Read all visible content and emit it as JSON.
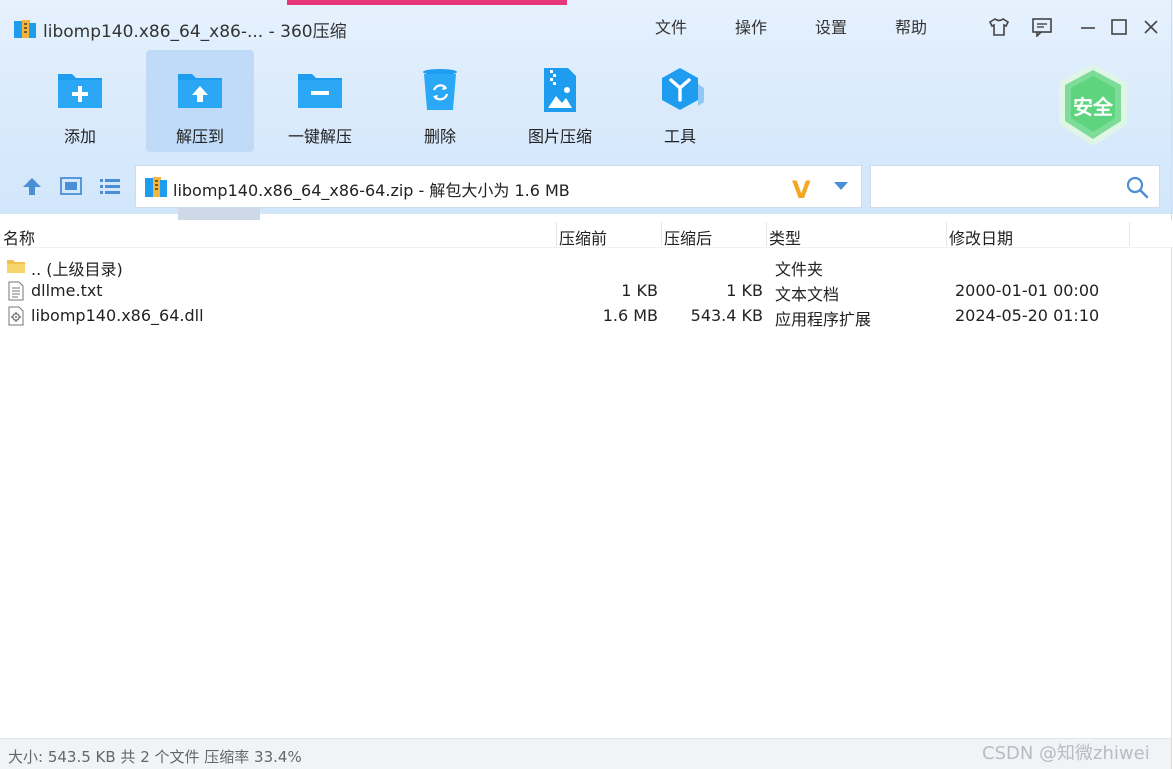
{
  "window": {
    "title": "libomp140.x86_64_x86-... - 360压缩",
    "menus": [
      "文件",
      "操作",
      "设置",
      "帮助"
    ]
  },
  "toolbar": {
    "add": "添加",
    "extract_to": "解压到",
    "one_click_extract": "一键解压",
    "delete": "删除",
    "image_compress": "图片压缩",
    "tools": "工具"
  },
  "shield": {
    "label": "安全"
  },
  "address": {
    "path": "libomp140.x86_64_x86-64.zip - 解包大小为 1.6 MB",
    "logo": "V"
  },
  "search": {
    "placeholder": ""
  },
  "columns": {
    "name": "名称",
    "compressed_before": "压缩前",
    "compressed_after": "压缩后",
    "type": "类型",
    "modified": "修改日期"
  },
  "files": [
    {
      "name": ".. (上级目录)",
      "before": "",
      "after": "",
      "type": "文件夹",
      "modified": "",
      "icon": "folder-icon"
    },
    {
      "name": "dllme.txt",
      "before": "1 KB",
      "after": "1 KB",
      "type": "文本文档",
      "modified": "2000-01-01 00:00",
      "icon": "text-file-icon"
    },
    {
      "name": "libomp140.x86_64.dll",
      "before": "1.6 MB",
      "after": "543.4 KB",
      "type": "应用程序扩展",
      "modified": "2024-05-20 01:10",
      "icon": "dll-file-icon"
    }
  ],
  "status": {
    "text": "大小: 543.5 KB 共 2 个文件 压缩率 33.4%"
  },
  "watermark": "CSDN @知微zhiwei",
  "colors": {
    "accent": "#1e9cf0",
    "toolbar_bg": "#d9eafc",
    "active_tool": "#bfdbf8",
    "shield": "#5fd47f"
  }
}
